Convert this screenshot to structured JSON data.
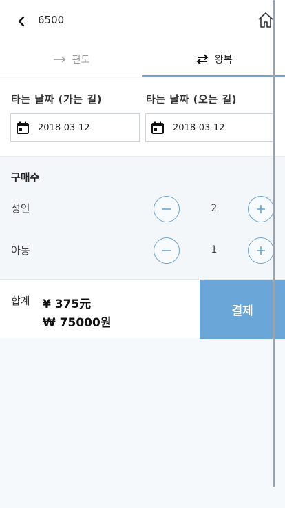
{
  "header": {
    "title": "6500",
    "back_icon": "chevron-left-icon",
    "home_icon": "home-icon"
  },
  "tabs": [
    {
      "label": "편도",
      "icon": "arrow-right-icon",
      "selected": false
    },
    {
      "label": "왕복",
      "icon": "swap-arrows-icon",
      "selected": true
    }
  ],
  "dates": {
    "depart_label": "타는 날짜 (가는 길)",
    "depart_value": "2018-03-12",
    "return_label": "타는 날짜 (오는 길)",
    "return_value": "2018-03-12"
  },
  "quantity": {
    "title": "구매수",
    "rows": [
      {
        "label": "성인",
        "value": "2"
      },
      {
        "label": "아동",
        "value": "1"
      }
    ]
  },
  "total": {
    "label": "합계",
    "cny": "¥ 375元",
    "krw": "₩ 75000원",
    "pay_label": "결제"
  },
  "colors": {
    "accent": "#6aa6d8"
  }
}
